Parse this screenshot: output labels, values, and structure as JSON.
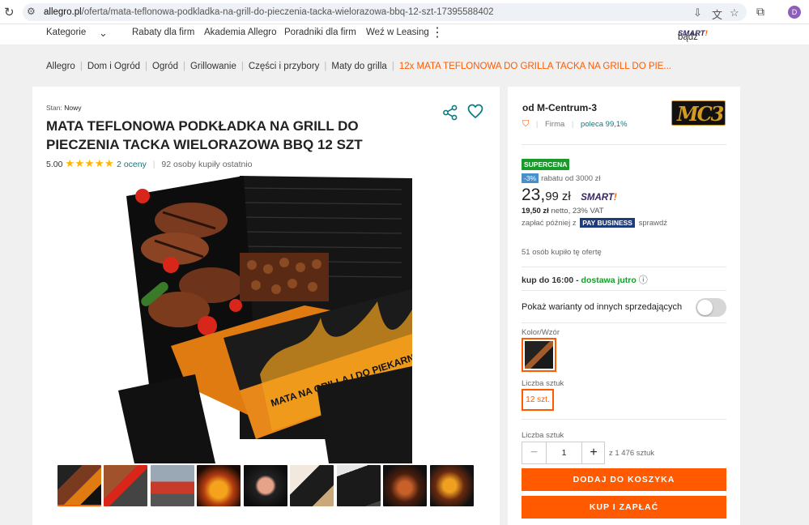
{
  "browser": {
    "url_domain": "allegro.pl",
    "url_path": "/oferta/mata-teflonowa-podkladka-na-grill-do-pieczenia-tacka-wielorazowa-bbq-12-szt-17395588402",
    "avatar_letter": "D"
  },
  "nav": {
    "kategorie": "Kategorie",
    "items": [
      "Rabaty dla firm",
      "Akademia Allegro",
      "Poradniki dla firm",
      "Weź w Leasing"
    ],
    "badz": "bądź",
    "smart": "SMART"
  },
  "breadcrumbs": [
    "Allegro",
    "Dom i Ogród",
    "Ogród",
    "Grillowanie",
    "Części i przybory",
    "Maty do grilla",
    "12x MATA TEFLONOWA DO GRILLA TACKA NA GRILL DO PIE..."
  ],
  "product": {
    "stan_label": "Stan:",
    "stan_value": "Nowy",
    "title": "MATA TEFLONOWA PODKŁADKA NA GRILL DO PIECZENIA TACKA WIELORAZOWA BBQ 12 SZT",
    "rating": "5.00",
    "stars": "★★★★★",
    "ratings_link": "2 oceny",
    "bought_recently": "92 osoby kupiły ostatnio",
    "box_text_1": "MATA NA GRILLA I DO PIEKARNIKA",
    "thumbnail_count": 9
  },
  "seller": {
    "name": "od M-Centrum-3",
    "logo_text": "MC3",
    "type": "Firma",
    "recommend": "poleca 99,1%"
  },
  "offer": {
    "supercena": "SUPERCENA",
    "discount_pct": "-3%",
    "discount_text": "rabatu od 3000 zł",
    "price_int": "23,",
    "price_dec": "99",
    "currency": "zł",
    "smart": "SMART",
    "netto_value": "19,50 zł",
    "netto_text": "netto, 23% VAT",
    "paylater_pre": "zapłać później z",
    "paylater_badge": "PAY BUSINESS",
    "paylater_post": "sprawdź",
    "bought_count": "51 osób kupiło tę ofertę",
    "delivery_pre": "kup do 16:00 -",
    "delivery_green": "dostawa jutro",
    "variants_label": "Pokaż warianty od innych sprzedających",
    "color_label": "Kolor/Wzór",
    "pieces_label": "Liczba sztuk",
    "pieces_value": "12 szt.",
    "qty_label": "Liczba sztuk",
    "qty_value": "1",
    "stock": "z 1 476 sztuk",
    "add_to_cart": "DODAJ DO KOSZYKA",
    "buy_now": "KUP I ZAPŁAĆ"
  },
  "colors": {
    "accent": "#ff5a00",
    "teal": "#0a7b7f",
    "green": "#1a9a2b"
  }
}
